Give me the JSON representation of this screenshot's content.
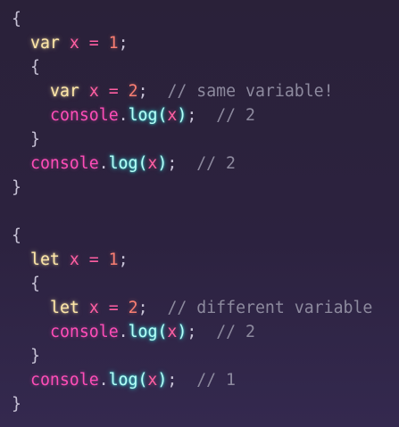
{
  "colors": {
    "background": "#2a2139",
    "punctuation": "#c7c2d6",
    "keyword": "#fee7a8",
    "variable": "#ff5fa2",
    "number": "#f97e72",
    "object": "#ff4db8",
    "function": "#b8fff7",
    "comment": "#8d8a9e"
  },
  "code": {
    "open_brace": "{",
    "close_brace": "}",
    "kw_var": "var",
    "kw_let": "let",
    "ident_x": "x",
    "op_assign": "=",
    "num_1": "1",
    "num_2": "2",
    "semicolon": ";",
    "console": "console",
    "dot": ".",
    "log": "log",
    "paren_open": "(",
    "paren_close": ")",
    "comment_same_variable": "// same variable!",
    "comment_2": "// 2",
    "comment_different_variable": "// different variable",
    "comment_1": "// 1"
  }
}
